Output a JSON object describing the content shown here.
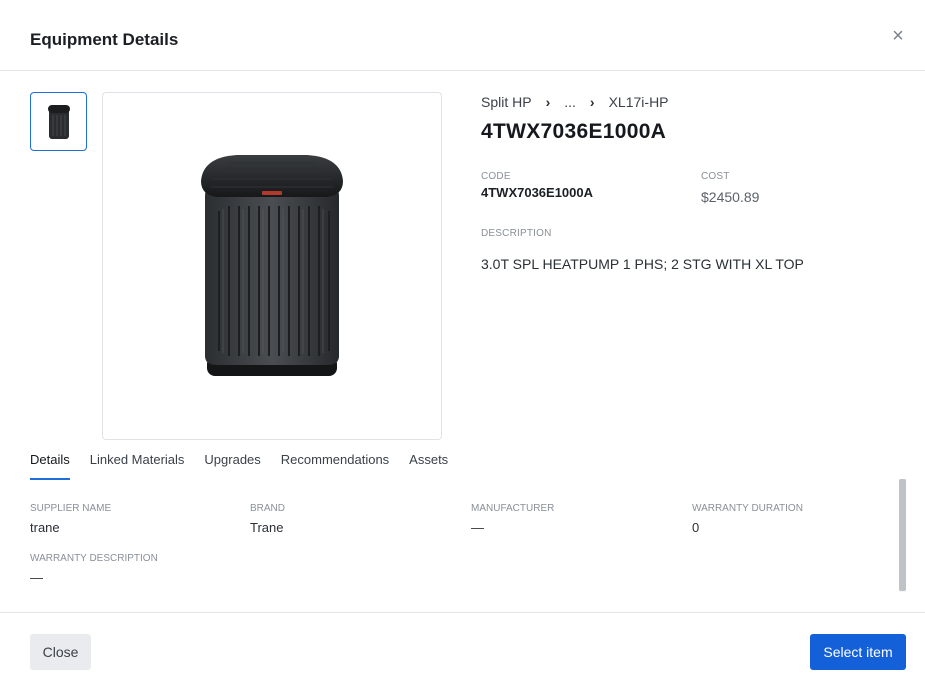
{
  "header": {
    "title": "Equipment Details"
  },
  "breadcrumb": [
    "Split HP",
    "...",
    "XL17i-HP"
  ],
  "product": {
    "model": "4TWX7036E1000A",
    "code_label": "CODE",
    "code": "4TWX7036E1000A",
    "cost_label": "COST",
    "cost": "$2450.89",
    "description_label": "DESCRIPTION",
    "description": "3.0T SPL HEATPUMP 1 PHS; 2 STG WITH XL TOP"
  },
  "tabs": [
    "Details",
    "Linked Materials",
    "Upgrades",
    "Recommendations",
    "Assets"
  ],
  "details": {
    "supplier_label": "SUPPLIER NAME",
    "supplier": "trane",
    "brand_label": "BRAND",
    "brand": "Trane",
    "manufacturer_label": "MANUFACTURER",
    "manufacturer": "—",
    "warranty_duration_label": "WARRANTY DURATION",
    "warranty_duration": "0",
    "warranty_description_label": "WARRANTY DESCRIPTION",
    "warranty_description": "—"
  },
  "footer": {
    "close_label": "Close",
    "select_label": "Select item"
  },
  "icons": {
    "close": "close-icon",
    "chevron": "chevron-right-icon"
  },
  "colors": {
    "accent": "#1460d8",
    "tab_underline": "#1e6fd9"
  }
}
